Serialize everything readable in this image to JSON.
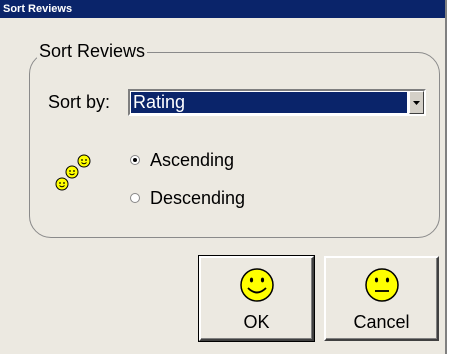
{
  "window": {
    "title": "Sort Reviews"
  },
  "group": {
    "label": "Sort Reviews"
  },
  "sort_by": {
    "label": "Sort by:",
    "selected": "Rating"
  },
  "order": {
    "options": [
      {
        "label": "Ascending",
        "checked": true
      },
      {
        "label": "Descending",
        "checked": false
      }
    ]
  },
  "buttons": {
    "ok_label": "OK",
    "cancel_label": "Cancel"
  },
  "icons": {
    "sort": "smiley-stack-icon",
    "ok": "happy-face-icon",
    "cancel": "neutral-face-icon",
    "dropdown": "chevron-down-icon"
  },
  "colors": {
    "title_bar": "#0a246a",
    "selection": "#0a246a",
    "dialog_bg": "#ece9e1",
    "smiley_yellow": "#ffff00"
  }
}
